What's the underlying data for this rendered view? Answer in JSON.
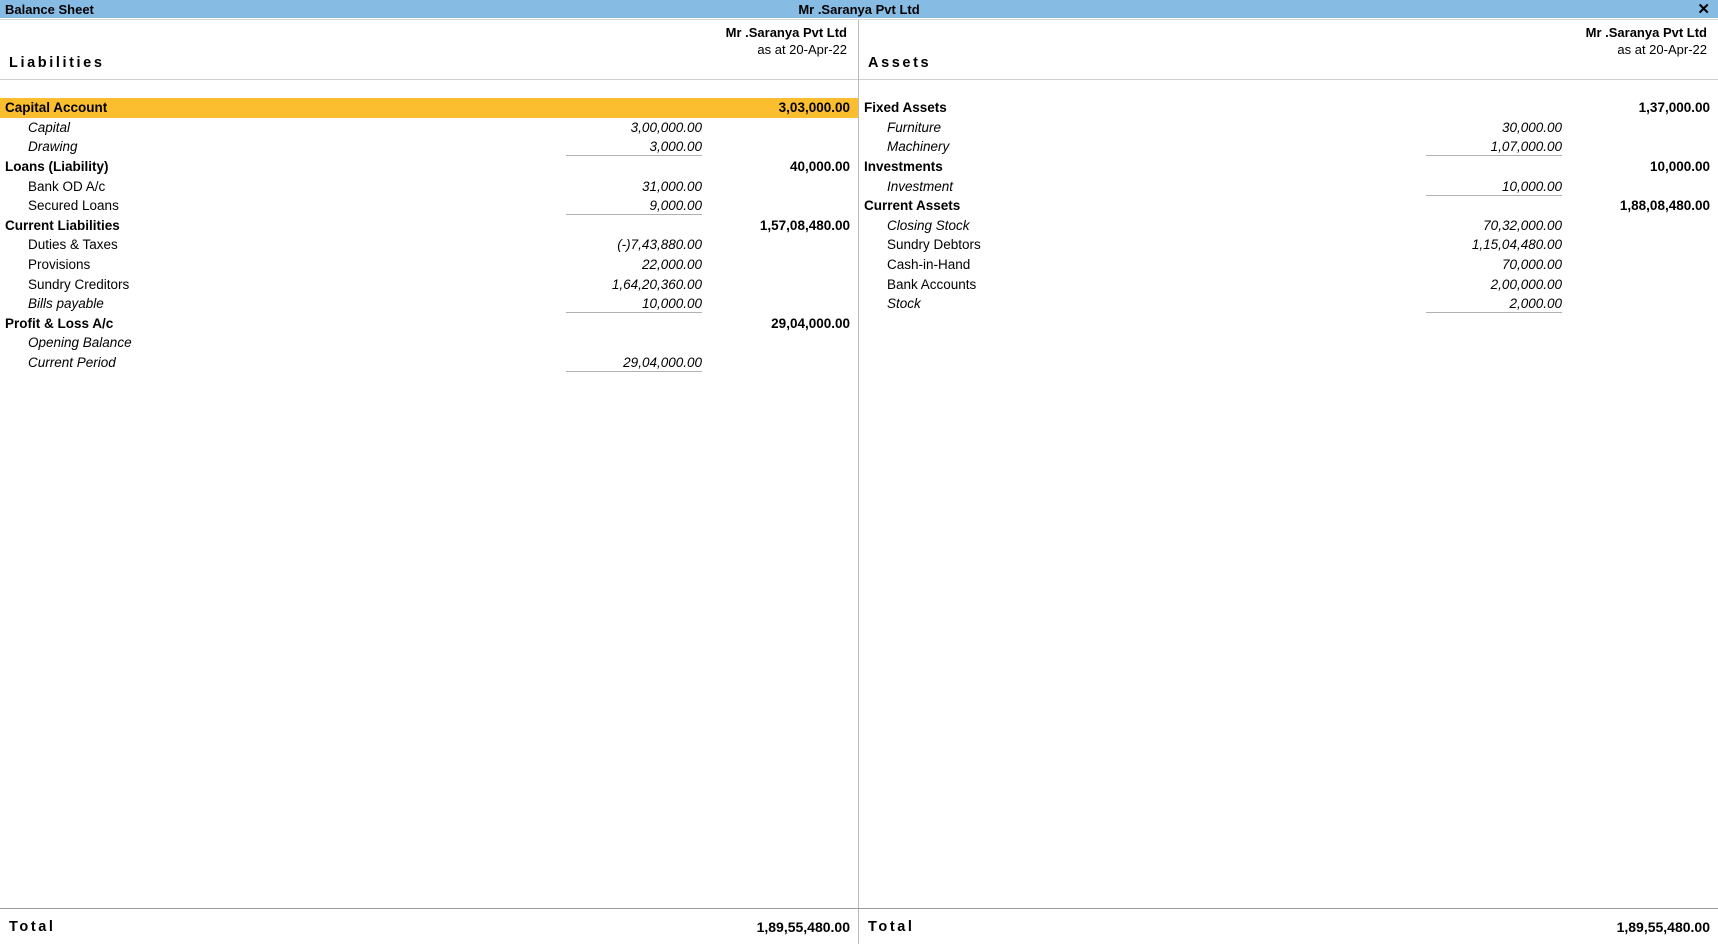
{
  "titlebar": {
    "left_title": "Balance Sheet",
    "center_title": "Mr .Saranya Pvt Ltd",
    "close_label": "✕"
  },
  "colors": {
    "titlebar_bg": "#86bce4",
    "highlight_row": "#fbbe2e",
    "text": "#000000",
    "rule": "#b0b0b0"
  },
  "left": {
    "side_title": "Liabilities",
    "company": "Mr .Saranya Pvt Ltd",
    "as_at": "as at 20-Apr-22",
    "total_label": "Total",
    "total_value": "1,89,55,480.00",
    "groups": [
      {
        "label": "Capital Account",
        "amount": "3,03,000.00",
        "highlight": true,
        "children": [
          {
            "label": "Capital",
            "amount": "3,00,000.00",
            "italic": true
          },
          {
            "label": "Drawing",
            "amount": "3,000.00",
            "italic": true
          }
        ]
      },
      {
        "label": "Loans (Liability)",
        "amount": "40,000.00",
        "highlight": false,
        "children": [
          {
            "label": "Bank OD A/c",
            "amount": "31,000.00",
            "italic": false
          },
          {
            "label": "Secured Loans",
            "amount": "9,000.00",
            "italic": false
          }
        ]
      },
      {
        "label": "Current Liabilities",
        "amount": "1,57,08,480.00",
        "highlight": false,
        "children": [
          {
            "label": "Duties & Taxes",
            "amount": "(-)7,43,880.00",
            "italic": false
          },
          {
            "label": "Provisions",
            "amount": "22,000.00",
            "italic": false
          },
          {
            "label": "Sundry Creditors",
            "amount": "1,64,20,360.00",
            "italic": false
          },
          {
            "label": "Bills payable",
            "amount": "10,000.00",
            "italic": true
          }
        ]
      },
      {
        "label": "Profit & Loss A/c",
        "amount": "29,04,000.00",
        "highlight": false,
        "children": [
          {
            "label": "Opening Balance",
            "amount": "",
            "italic": true
          },
          {
            "label": "Current Period",
            "amount": "29,04,000.00",
            "italic": true
          }
        ]
      }
    ]
  },
  "right": {
    "side_title": "Assets",
    "company": "Mr .Saranya Pvt Ltd",
    "as_at": "as at 20-Apr-22",
    "total_label": "Total",
    "total_value": "1,89,55,480.00",
    "groups": [
      {
        "label": "Fixed Assets",
        "amount": "1,37,000.00",
        "highlight": false,
        "children": [
          {
            "label": "Furniture",
            "amount": "30,000.00",
            "italic": true
          },
          {
            "label": "Machinery",
            "amount": "1,07,000.00",
            "italic": true
          }
        ]
      },
      {
        "label": "Investments",
        "amount": "10,000.00",
        "highlight": false,
        "children": [
          {
            "label": "Investment",
            "amount": "10,000.00",
            "italic": true
          }
        ]
      },
      {
        "label": "Current Assets",
        "amount": "1,88,08,480.00",
        "highlight": false,
        "children": [
          {
            "label": "Closing Stock",
            "amount": "70,32,000.00",
            "italic": true
          },
          {
            "label": "Sundry Debtors",
            "amount": "1,15,04,480.00",
            "italic": false
          },
          {
            "label": "Cash-in-Hand",
            "amount": "70,000.00",
            "italic": false
          },
          {
            "label": "Bank Accounts",
            "amount": "2,00,000.00",
            "italic": false
          },
          {
            "label": "Stock",
            "amount": "2,000.00",
            "italic": true
          }
        ]
      }
    ]
  }
}
